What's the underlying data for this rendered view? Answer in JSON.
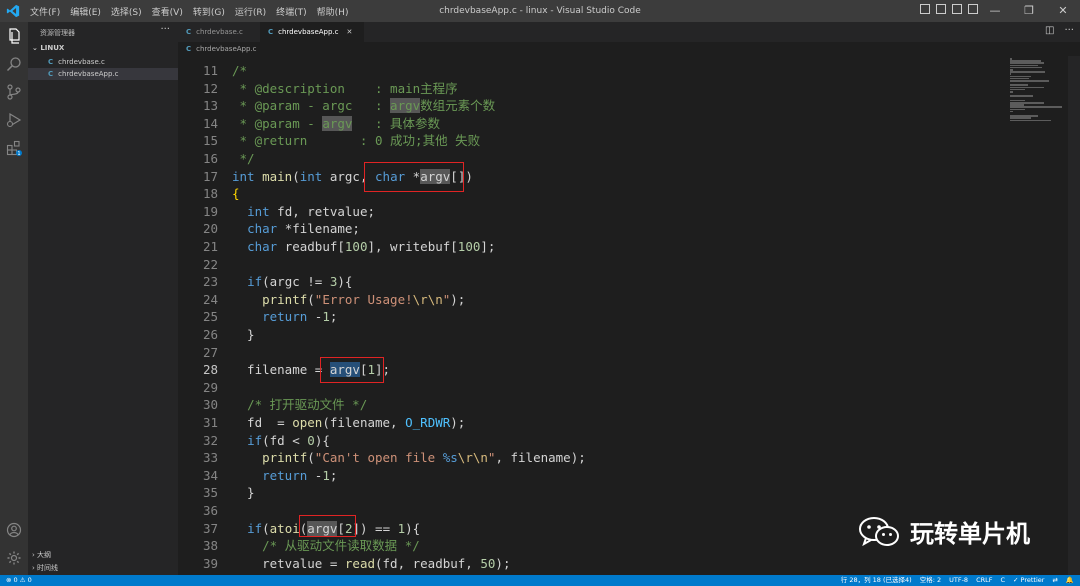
{
  "titlebar": {
    "menu": [
      "文件(F)",
      "编辑(E)",
      "选择(S)",
      "查看(V)",
      "转到(G)",
      "运行(R)",
      "终端(T)",
      "帮助(H)"
    ],
    "title": "chrdevbaseApp.c - linux - Visual Studio Code",
    "controls": [
      "—",
      "❐",
      "✕"
    ]
  },
  "activity_icons": [
    "explorer-icon",
    "search-icon",
    "source-control-icon",
    "run-debug-icon",
    "extensions-icon",
    "account-icon",
    "settings-gear-icon"
  ],
  "extensions_badge": "1",
  "sidebar": {
    "header": "资源管理器",
    "more": "···",
    "folder": "LINUX",
    "files": [
      {
        "icon": "C",
        "name": "chrdevbase.c"
      },
      {
        "icon": "C",
        "name": "chrdevbaseApp.c"
      }
    ],
    "outline": "大纲",
    "timeline": "时间线"
  },
  "tabs": [
    {
      "icon": "C",
      "label": "chrdevbase.c"
    },
    {
      "icon": "C",
      "label": "chrdevbaseApp.c",
      "close": "✕"
    }
  ],
  "breadcrumb": {
    "icon": "C",
    "label": "chrdevbaseApp.c"
  },
  "current_line": "28",
  "code_lines": [
    {
      "n": "11",
      "segs": [
        [
          "cm",
          "/*"
        ]
      ]
    },
    {
      "n": "12",
      "segs": [
        [
          "cm",
          " * @description    : main主程序"
        ]
      ]
    },
    {
      "n": "13",
      "segs": [
        [
          "cm",
          " * @param - argc   : "
        ],
        [
          "cmhlw",
          "argv"
        ],
        [
          "cm",
          "数组元素个数"
        ]
      ]
    },
    {
      "n": "14",
      "segs": [
        [
          "cm",
          " * @param - "
        ],
        [
          "cmhlw",
          "argv"
        ],
        [
          "cm",
          "   : 具体参数"
        ]
      ]
    },
    {
      "n": "15",
      "segs": [
        [
          "cm",
          " * @return       : 0 成功;其他 失败"
        ]
      ]
    },
    {
      "n": "16",
      "segs": [
        [
          "cm",
          " */"
        ]
      ]
    },
    {
      "n": "17",
      "segs": [
        [
          "kw",
          "int"
        ],
        [
          "",
          " "
        ],
        [
          "fn",
          "main"
        ],
        [
          "",
          "("
        ],
        [
          "kw",
          "int"
        ],
        [
          "",
          " argc, "
        ],
        [
          "kw",
          "char"
        ],
        [
          "",
          " *"
        ],
        [
          "hlw",
          "argv"
        ],
        [
          "",
          "[])"
        ]
      ]
    },
    {
      "n": "18",
      "segs": [
        [
          "par",
          "{"
        ]
      ]
    },
    {
      "n": "19",
      "segs": [
        [
          "",
          "  "
        ],
        [
          "kw",
          "int"
        ],
        [
          "",
          " fd, retvalue;"
        ]
      ]
    },
    {
      "n": "20",
      "segs": [
        [
          "",
          "  "
        ],
        [
          "kw",
          "char"
        ],
        [
          "",
          " *filename;"
        ]
      ]
    },
    {
      "n": "21",
      "segs": [
        [
          "",
          "  "
        ],
        [
          "kw",
          "char"
        ],
        [
          "",
          " readbuf["
        ],
        [
          "num",
          "100"
        ],
        [
          "",
          "], writebuf["
        ],
        [
          "num",
          "100"
        ],
        [
          "",
          "];"
        ]
      ]
    },
    {
      "n": "22",
      "segs": [
        [
          "",
          ""
        ]
      ]
    },
    {
      "n": "23",
      "segs": [
        [
          "",
          "  "
        ],
        [
          "kw",
          "if"
        ],
        [
          "",
          "(argc != "
        ],
        [
          "num",
          "3"
        ],
        [
          "",
          "){"
        ]
      ]
    },
    {
      "n": "24",
      "segs": [
        [
          "",
          "    "
        ],
        [
          "fn",
          "printf"
        ],
        [
          "",
          "("
        ],
        [
          "str",
          "\"Error Usage!"
        ],
        [
          "esc",
          "\\r\\n"
        ],
        [
          "str",
          "\""
        ],
        [
          "",
          ");"
        ]
      ]
    },
    {
      "n": "25",
      "segs": [
        [
          "",
          "    "
        ],
        [
          "kw",
          "return"
        ],
        [
          "",
          " -"
        ],
        [
          "num",
          "1"
        ],
        [
          "",
          ";"
        ]
      ]
    },
    {
      "n": "26",
      "segs": [
        [
          "",
          "  }"
        ]
      ]
    },
    {
      "n": "27",
      "segs": [
        [
          "",
          ""
        ]
      ]
    },
    {
      "n": "28",
      "segs": [
        [
          "",
          "  filename = "
        ],
        [
          "hl",
          "argv"
        ],
        [
          "",
          "["
        ],
        [
          "num",
          "1"
        ],
        [
          "",
          "];"
        ]
      ]
    },
    {
      "n": "29",
      "segs": [
        [
          "",
          ""
        ]
      ]
    },
    {
      "n": "30",
      "segs": [
        [
          "",
          "  "
        ],
        [
          "cm",
          "/* 打开驱动文件 */"
        ]
      ]
    },
    {
      "n": "31",
      "segs": [
        [
          "",
          "  fd  = "
        ],
        [
          "fn",
          "open"
        ],
        [
          "",
          "(filename, "
        ],
        [
          "mac",
          "O_RDWR"
        ],
        [
          "",
          ");"
        ]
      ]
    },
    {
      "n": "32",
      "segs": [
        [
          "",
          "  "
        ],
        [
          "kw",
          "if"
        ],
        [
          "",
          "(fd < "
        ],
        [
          "num",
          "0"
        ],
        [
          "",
          "){"
        ]
      ]
    },
    {
      "n": "33",
      "segs": [
        [
          "",
          "    "
        ],
        [
          "fn",
          "printf"
        ],
        [
          "",
          "("
        ],
        [
          "str",
          "\"Can't open file "
        ],
        [
          "kw",
          "%s"
        ],
        [
          "esc",
          "\\r\\n"
        ],
        [
          "str",
          "\""
        ],
        [
          "",
          ", filename);"
        ]
      ]
    },
    {
      "n": "34",
      "segs": [
        [
          "",
          "    "
        ],
        [
          "kw",
          "return"
        ],
        [
          "",
          " -"
        ],
        [
          "num",
          "1"
        ],
        [
          "",
          ";"
        ]
      ]
    },
    {
      "n": "35",
      "segs": [
        [
          "",
          "  }"
        ]
      ]
    },
    {
      "n": "36",
      "segs": [
        [
          "",
          ""
        ]
      ]
    },
    {
      "n": "37",
      "segs": [
        [
          "",
          "  "
        ],
        [
          "kw",
          "if"
        ],
        [
          "",
          "("
        ],
        [
          "fn",
          "atoi"
        ],
        [
          "",
          "("
        ],
        [
          "hlw",
          "argv"
        ],
        [
          "",
          "["
        ],
        [
          "num",
          "2"
        ],
        [
          "",
          "]) == "
        ],
        [
          "num",
          "1"
        ],
        [
          "",
          "){"
        ]
      ]
    },
    {
      "n": "38",
      "segs": [
        [
          "",
          "    "
        ],
        [
          "cm",
          "/* 从驱动文件读取数据 */"
        ]
      ]
    },
    {
      "n": "39",
      "segs": [
        [
          "",
          "    retvalue = "
        ],
        [
          "fn",
          "read"
        ],
        [
          "",
          "(fd, readbuf, "
        ],
        [
          "num",
          "50"
        ],
        [
          "",
          ");"
        ]
      ]
    }
  ],
  "watermark": {
    "icon": "wechat-icon",
    "text": "玩转单片机"
  },
  "statusbar": {
    "left": "⊗ 0 ⚠ 0",
    "items": [
      "行 28，列 18 (已选择4)",
      "空格: 2",
      "UTF-8",
      "CRLF",
      "C",
      "✓ Prettier",
      "⇄",
      "🔔"
    ]
  },
  "colors": {
    "accent": "#007acc",
    "highlight_box": "#e02424"
  }
}
